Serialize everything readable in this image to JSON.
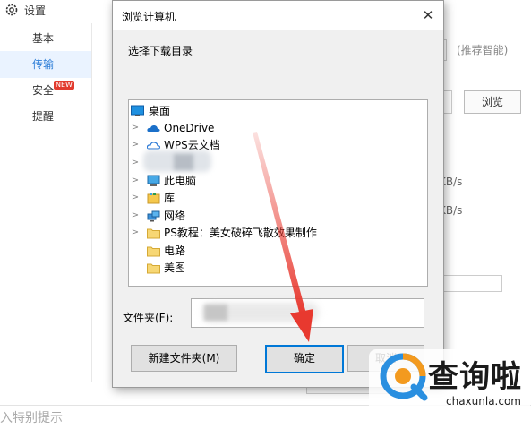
{
  "app": {
    "title": "设置",
    "sidebar": [
      {
        "label": "基本"
      },
      {
        "label": "传输"
      },
      {
        "label": "安全",
        "badge": "NEW"
      },
      {
        "label": "提醒"
      }
    ],
    "hint_text": "(推荐智能)",
    "browse_label": "浏览",
    "speed_unit_1": "KB/s",
    "speed_unit_2": "KB/s",
    "footer_text": "入特别提示"
  },
  "dialog": {
    "title": "浏览计算机",
    "close_glyph": "✕",
    "description": "选择下载目录",
    "tree": [
      {
        "label": "桌面",
        "icon": "desktop-icon",
        "level": 0,
        "expandable": false
      },
      {
        "label": "OneDrive",
        "icon": "onedrive-cloud-icon",
        "level": 1,
        "expandable": true
      },
      {
        "label": "WPS云文档",
        "icon": "wps-cloud-icon",
        "level": 1,
        "expandable": true
      },
      {
        "label": "",
        "icon": "user-folder-icon",
        "level": 1,
        "expandable": true,
        "blurred": true
      },
      {
        "label": "此电脑",
        "icon": "computer-icon",
        "level": 1,
        "expandable": true
      },
      {
        "label": "库",
        "icon": "library-icon",
        "level": 1,
        "expandable": true
      },
      {
        "label": "网络",
        "icon": "network-icon",
        "level": 1,
        "expandable": true
      },
      {
        "label": "PS教程：美女破碎飞散效果制作",
        "icon": "folder-icon",
        "level": 1,
        "expandable": true
      },
      {
        "label": "电路",
        "icon": "folder-icon",
        "level": 1,
        "expandable": false
      },
      {
        "label": "美图",
        "icon": "folder-icon",
        "level": 1,
        "expandable": false
      }
    ],
    "folder_label": "文件夹(F):",
    "folder_value": "",
    "new_folder_button": "新建文件夹(M)",
    "ok_button": "确定",
    "cancel_button": "取消"
  },
  "watermark": {
    "brand_cn": "查询啦",
    "brand_url": "chaxunla.com"
  },
  "colors": {
    "accent": "#0078d7",
    "arrow": "#e8392f",
    "folder": "#f7d774"
  }
}
